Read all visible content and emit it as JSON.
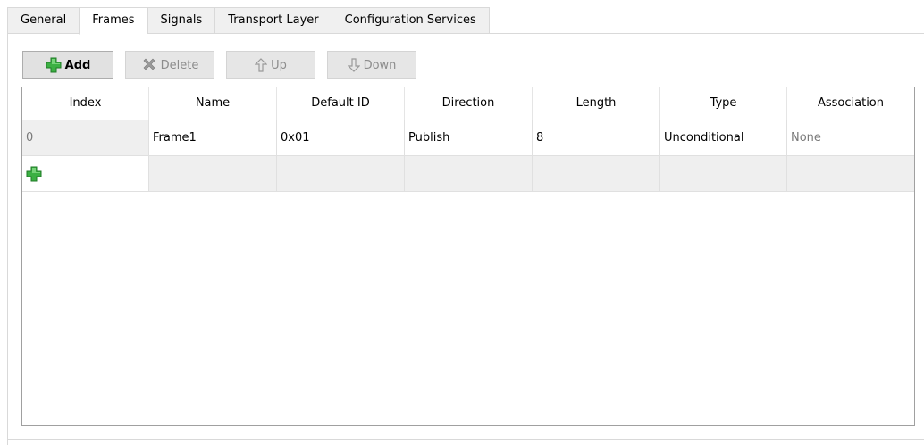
{
  "tabs": [
    {
      "label": "General",
      "active": false
    },
    {
      "label": "Frames",
      "active": true
    },
    {
      "label": "Signals",
      "active": false
    },
    {
      "label": "Transport Layer",
      "active": false
    },
    {
      "label": "Configuration Services",
      "active": false
    }
  ],
  "toolbar": {
    "add_label": "Add",
    "delete_label": "Delete",
    "up_label": "Up",
    "down_label": "Down"
  },
  "grid": {
    "columns": [
      "Index",
      "Name",
      "Default ID",
      "Direction",
      "Length",
      "Type",
      "Association"
    ],
    "rows": [
      [
        "0",
        "Frame1",
        "0x01",
        "Publish",
        "8",
        "Unconditional",
        "None"
      ]
    ]
  },
  "colors": {
    "add_icon_green": "#3cb043",
    "disabled_text": "#8c8c8c",
    "grey_cell": "#efefef"
  },
  "icons": {
    "add": "plus-icon",
    "delete": "cross-icon",
    "up": "arrow-up-icon",
    "down": "arrow-down-icon",
    "new_row": "plus-icon"
  }
}
